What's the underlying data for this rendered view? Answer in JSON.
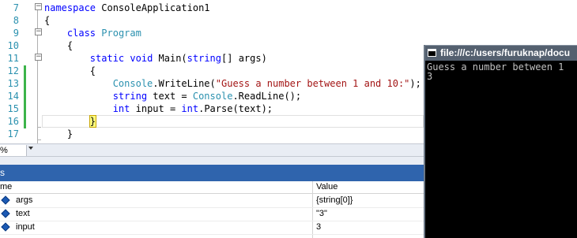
{
  "editor": {
    "line_numbers": [
      "7",
      "8",
      "9",
      "10",
      "11",
      "12",
      "13",
      "14",
      "15",
      "16",
      "17"
    ],
    "lines": [
      [
        {
          "t": "namespace",
          "c": "kw"
        },
        {
          "t": " ConsoleApplication1",
          "c": ""
        }
      ],
      [
        {
          "t": "{",
          "c": ""
        }
      ],
      [
        {
          "t": "    ",
          "c": ""
        },
        {
          "t": "class",
          "c": "kw"
        },
        {
          "t": " ",
          "c": ""
        },
        {
          "t": "Program",
          "c": "type"
        }
      ],
      [
        {
          "t": "    {",
          "c": ""
        }
      ],
      [
        {
          "t": "        ",
          "c": ""
        },
        {
          "t": "static",
          "c": "kw"
        },
        {
          "t": " ",
          "c": ""
        },
        {
          "t": "void",
          "c": "kw"
        },
        {
          "t": " Main(",
          "c": ""
        },
        {
          "t": "string",
          "c": "kw"
        },
        {
          "t": "[] args)",
          "c": ""
        }
      ],
      [
        {
          "t": "        {",
          "c": ""
        }
      ],
      [
        {
          "t": "            ",
          "c": ""
        },
        {
          "t": "Console",
          "c": "type"
        },
        {
          "t": ".WriteLine(",
          "c": ""
        },
        {
          "t": "\"Guess a number between 1 and 10:\"",
          "c": "str"
        },
        {
          "t": ");",
          "c": ""
        }
      ],
      [
        {
          "t": "            ",
          "c": ""
        },
        {
          "t": "string",
          "c": "kw"
        },
        {
          "t": " text = ",
          "c": ""
        },
        {
          "t": "Console",
          "c": "type"
        },
        {
          "t": ".ReadLine();",
          "c": ""
        }
      ],
      [
        {
          "t": "            ",
          "c": ""
        },
        {
          "t": "int",
          "c": "kw"
        },
        {
          "t": " input = ",
          "c": ""
        },
        {
          "t": "int",
          "c": "kw"
        },
        {
          "t": ".Parse(text);",
          "c": ""
        }
      ],
      [
        {
          "t": "        ",
          "c": ""
        },
        {
          "t": "}",
          "c": "brace"
        }
      ],
      [
        {
          "t": "    }",
          "c": ""
        }
      ]
    ]
  },
  "zoom": {
    "value": "%"
  },
  "locals": {
    "title": "s",
    "headers": {
      "name": "me",
      "value": "Value"
    },
    "rows": [
      {
        "name": "args",
        "value": "{string[0]}"
      },
      {
        "name": "text",
        "value": "\"3\""
      },
      {
        "name": "input",
        "value": "3"
      }
    ]
  },
  "console": {
    "title": "file:///c:/users/furuknap/docu",
    "lines": [
      "Guess a number between 1",
      "3"
    ]
  },
  "colors": {
    "keyword": "#0000ff",
    "type": "#2b91af",
    "string": "#a31515",
    "panel_title_bg": "#2f64ad",
    "change_bar": "#3cb44a"
  }
}
